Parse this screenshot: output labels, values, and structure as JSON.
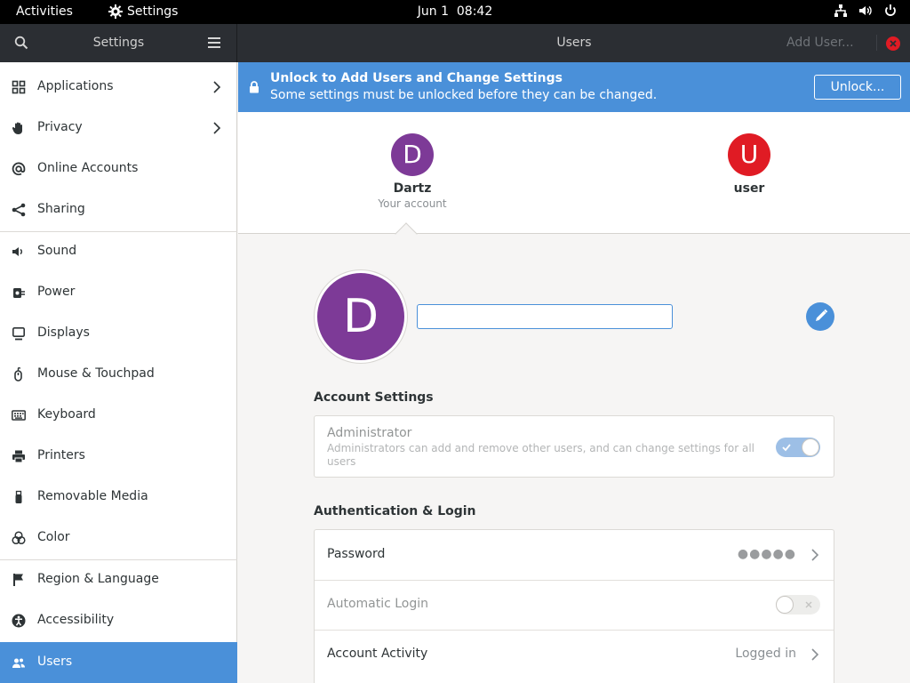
{
  "topbar": {
    "activities": "Activities",
    "app_name": "Settings",
    "date": "Jun 1",
    "time": "08:42"
  },
  "header": {
    "sidebar_title": "Settings",
    "page_title": "Users",
    "add_user": "Add User..."
  },
  "sidebar": {
    "items": [
      {
        "label": "Applications",
        "icon": "grid-icon"
      },
      {
        "label": "Privacy",
        "icon": "hand-icon"
      },
      {
        "label": "Online Accounts",
        "icon": "at-icon"
      },
      {
        "label": "Sharing",
        "icon": "share-icon"
      },
      {
        "label": "Sound",
        "icon": "speaker-icon"
      },
      {
        "label": "Power",
        "icon": "power-plug-icon"
      },
      {
        "label": "Displays",
        "icon": "monitor-icon"
      },
      {
        "label": "Mouse & Touchpad",
        "icon": "mouse-icon"
      },
      {
        "label": "Keyboard",
        "icon": "keyboard-icon"
      },
      {
        "label": "Printers",
        "icon": "printer-icon"
      },
      {
        "label": "Removable Media",
        "icon": "usb-icon"
      },
      {
        "label": "Color",
        "icon": "color-icon"
      },
      {
        "label": "Region & Language",
        "icon": "flag-icon"
      },
      {
        "label": "Accessibility",
        "icon": "accessibility-icon"
      },
      {
        "label": "Users",
        "icon": "users-icon"
      }
    ]
  },
  "unlock_bar": {
    "title": "Unlock to Add Users and Change Settings",
    "subtitle": "Some settings must be unlocked before they can be changed.",
    "button": "Unlock..."
  },
  "users": [
    {
      "initial": "D",
      "name": "Dartz",
      "subtitle": "Your account",
      "color": "#7d3a97"
    },
    {
      "initial": "U",
      "name": "user",
      "subtitle": "",
      "color": "#e01b24"
    }
  ],
  "profile": {
    "initial": "D",
    "name_value": ""
  },
  "account_settings": {
    "heading": "Account Settings",
    "admin_label": "Administrator",
    "admin_desc": "Administrators can add and remove other users, and can change settings for all users",
    "admin_enabled": true
  },
  "auth": {
    "heading": "Authentication & Login",
    "password_label": "Password",
    "password_value": "●●●●●",
    "autologin_label": "Automatic Login",
    "autologin_enabled": false,
    "activity_label": "Account Activity",
    "activity_value": "Logged in"
  },
  "colors": {
    "accent": "#4a90d9",
    "close": "#e01b24"
  }
}
